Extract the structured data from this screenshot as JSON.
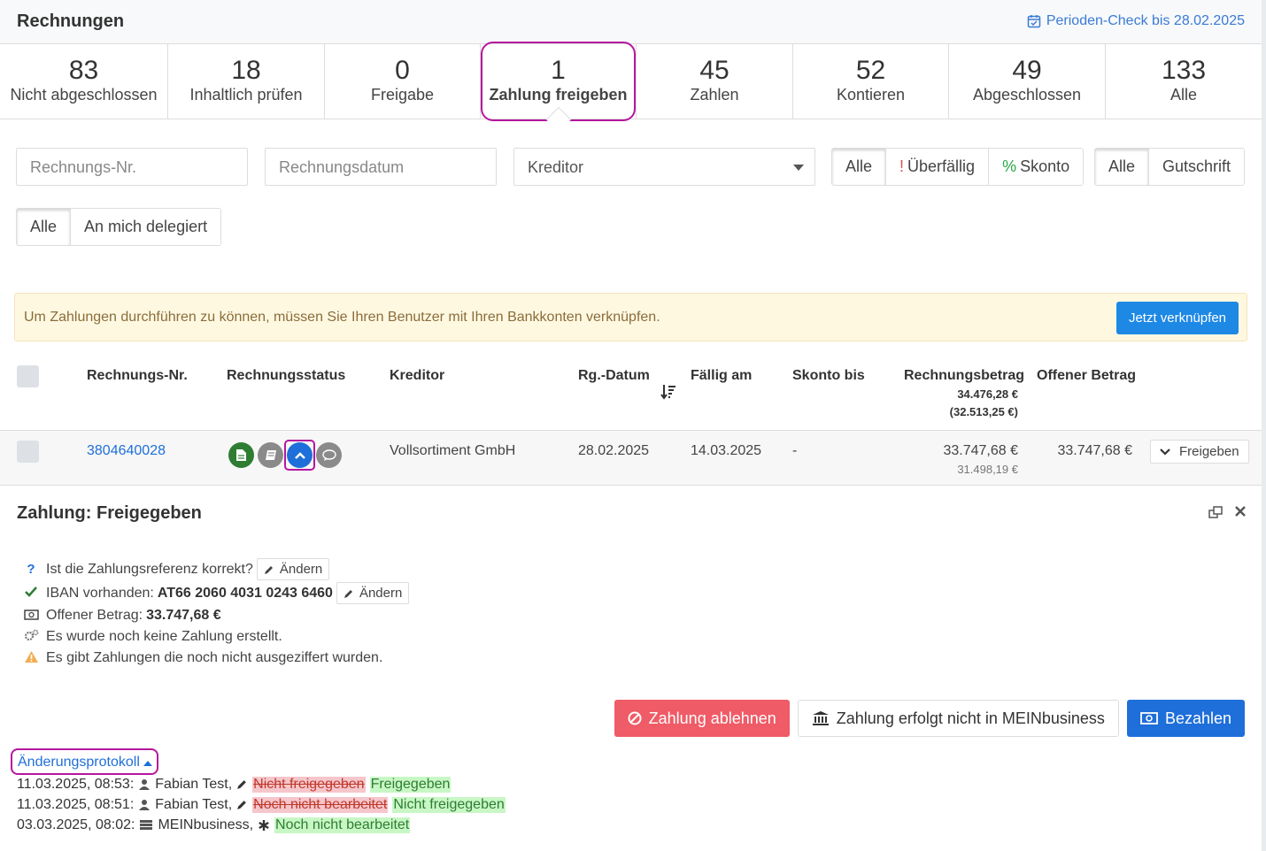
{
  "header": {
    "title": "Rechnungen",
    "period_check": "Perioden-Check bis 28.02.2025"
  },
  "tabs": [
    {
      "count": "83",
      "label": "Nicht abgeschlossen"
    },
    {
      "count": "18",
      "label": "Inhaltlich prüfen"
    },
    {
      "count": "0",
      "label": "Freigabe"
    },
    {
      "count": "1",
      "label": "Zahlung freigeben"
    },
    {
      "count": "45",
      "label": "Zahlen"
    },
    {
      "count": "52",
      "label": "Kontieren"
    },
    {
      "count": "49",
      "label": "Abgeschlossen"
    },
    {
      "count": "133",
      "label": "Alle"
    }
  ],
  "active_tab_index": 3,
  "filters": {
    "invoice_no_placeholder": "Rechnungs-Nr.",
    "invoice_date_placeholder": "Rechnungsdatum",
    "creditor_placeholder": "Kreditor",
    "due_group": {
      "all": "Alle",
      "overdue_mark": "!",
      "overdue": "Überfällig",
      "discount_mark": "%",
      "discount": "Skonto"
    },
    "type_group": {
      "all": "Alle",
      "credit": "Gutschrift"
    },
    "delegation_group": {
      "all": "Alle",
      "delegated": "An mich delegiert"
    }
  },
  "alert": {
    "message": "Um Zahlungen durchführen zu können, müssen Sie Ihren Benutzer mit Ihren Bankkonten verknüpfen.",
    "button": "Jetzt verknüpfen"
  },
  "table": {
    "headers": {
      "invoice_no": "Rechnungs-Nr.",
      "status": "Rechnungsstatus",
      "creditor": "Kreditor",
      "invoice_date": "Rg.-Datum",
      "due": "Fällig am",
      "discount_until": "Skonto bis",
      "amount": "Rechnungsbetrag",
      "amount_total": "34.476,28 €",
      "amount_total_net": "(32.513,25 €)",
      "open_amount": "Offener Betrag"
    },
    "rows": [
      {
        "invoice_no": "3804640028",
        "creditor": "Vollsortiment GmbH",
        "invoice_date": "28.02.2025",
        "due": "14.03.2025",
        "discount_until": "-",
        "amount": "33.747,68 €",
        "amount_net": "31.498,19 €",
        "open_amount": "33.747,68 €",
        "action": "Freigeben"
      }
    ]
  },
  "panel": {
    "title": "Zahlung: Freigegeben",
    "checks": [
      {
        "icon": "question-icon",
        "text": "Ist die Zahlungsreferenz korrekt?",
        "edit": "Ändern"
      },
      {
        "icon": "check-icon",
        "text": "IBAN vorhanden:",
        "value": "AT66 2060 4031 0243 6460",
        "edit": "Ändern"
      },
      {
        "icon": "money-icon",
        "text": "Offener Betrag:",
        "value": "33.747,68 €"
      },
      {
        "icon": "cogs-icon",
        "text": "Es wurde noch keine Zahlung erstellt."
      },
      {
        "icon": "warning-icon",
        "text": "Es gibt Zahlungen die noch nicht ausgeziffert wurden."
      }
    ],
    "actions": {
      "reject": "Zahlung ablehnen",
      "external": "Zahlung erfolgt nicht in MEINbusiness",
      "pay": "Bezahlen"
    }
  },
  "changelog": {
    "toggle": "Änderungsprotokoll",
    "entries": [
      {
        "time": "11.03.2025, 08:53:",
        "user": "Fabian Test,",
        "old": "Nicht freigegeben",
        "new": "Freigegeben",
        "kind": "edit"
      },
      {
        "time": "11.03.2025, 08:51:",
        "user": "Fabian Test,",
        "old": "Noch nicht bearbeitet",
        "new": "Nicht freigegeben",
        "kind": "edit"
      },
      {
        "time": "03.03.2025, 08:02:",
        "user": "MEINbusiness,",
        "old": "",
        "new": "Noch nicht bearbeitet",
        "kind": "create"
      }
    ]
  },
  "colors": {
    "accent": "#1e6fd9",
    "highlight": "#b5179e",
    "danger": "#ef5b66",
    "alert_bg": "#fff8e1"
  }
}
